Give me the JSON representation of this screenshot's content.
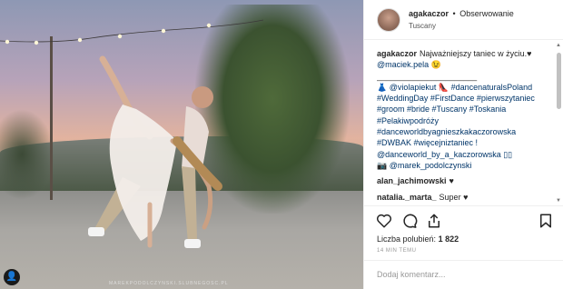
{
  "post": {
    "watermark": "MAREKPODOLCZYNSKI.SLUBNEGOSC.PL"
  },
  "header": {
    "username": "agakaczor",
    "separator": "•",
    "follow_label": "Obserwowanie",
    "location": "Tuscany"
  },
  "caption": {
    "username": "agakaczor",
    "text": "Najważniejszy taniec w życiu.♥",
    "lines": [
      "@maciek.pela 😉",
      "______________________",
      "👗 @violapiekut 👠 #dancenaturalsPoland",
      "#WeddingDay #FirstDance #pierwszytaniec",
      "#groom #bride #Tuscany #Toskania",
      "#Pelakiwpodróży",
      "#danceworldbyagnieszkakaczorowska",
      "#DWBAK #więcejniztaniec !",
      "@danceworld_by_a_kaczorowska ▯▯",
      "📷 @marek_podolczynski"
    ]
  },
  "comments": [
    {
      "username": "alan_jachimowski",
      "text": "♥"
    },
    {
      "username": "natalia._marta_",
      "text": "Super ♥"
    }
  ],
  "actions": {
    "like_icon": "heart-icon",
    "comment_icon": "comment-icon",
    "share_icon": "share-icon",
    "save_icon": "bookmark-icon"
  },
  "likes": {
    "label": "Liczba polubień:",
    "count": "1 822"
  },
  "timestamp": "14 MIN TEMU",
  "add_comment": {
    "placeholder": "Dodaj komentarz..."
  }
}
